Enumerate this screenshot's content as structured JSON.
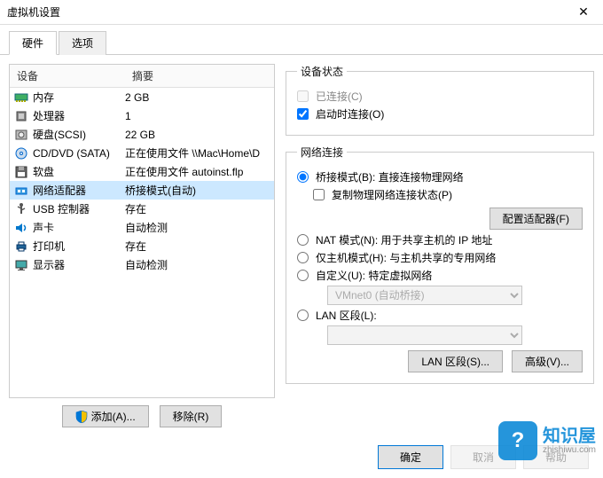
{
  "window": {
    "title": "虚拟机设置",
    "close": "✕"
  },
  "tabs": [
    {
      "label": "硬件",
      "active": true
    },
    {
      "label": "选项",
      "active": false
    }
  ],
  "hw_header": {
    "device": "设备",
    "summary": "摘要"
  },
  "hardware": [
    {
      "icon": "memory",
      "name": "内存",
      "summary": "2 GB"
    },
    {
      "icon": "cpu",
      "name": "处理器",
      "summary": "1"
    },
    {
      "icon": "hdd",
      "name": "硬盘(SCSI)",
      "summary": "22 GB"
    },
    {
      "icon": "cd",
      "name": "CD/DVD (SATA)",
      "summary": "正在使用文件 \\\\Mac\\Home\\D"
    },
    {
      "icon": "floppy",
      "name": "软盘",
      "summary": "正在使用文件 autoinst.flp"
    },
    {
      "icon": "net",
      "name": "网络适配器",
      "summary": "桥接模式(自动)",
      "selected": true
    },
    {
      "icon": "usb",
      "name": "USB 控制器",
      "summary": "存在"
    },
    {
      "icon": "sound",
      "name": "声卡",
      "summary": "自动检测"
    },
    {
      "icon": "printer",
      "name": "打印机",
      "summary": "存在"
    },
    {
      "icon": "display",
      "name": "显示器",
      "summary": "自动检测"
    }
  ],
  "buttons": {
    "add": "添加(A)...",
    "remove": "移除(R)"
  },
  "device_state": {
    "legend": "设备状态",
    "connected": "已连接(C)",
    "connect_on_power": "启动时连接(O)"
  },
  "net_conn": {
    "legend": "网络连接",
    "bridged": "桥接模式(B): 直接连接物理网络",
    "copy_state": "复制物理网络连接状态(P)",
    "configure": "配置适配器(F)",
    "nat": "NAT 模式(N): 用于共享主机的 IP 地址",
    "host_only": "仅主机模式(H): 与主机共享的专用网络",
    "custom": "自定义(U): 特定虚拟网络",
    "vmnet_sel": "VMnet0 (自动桥接)",
    "lan_seg": "LAN 区段(L):",
    "lan_seg_btn": "LAN 区段(S)...",
    "advanced": "高级(V)..."
  },
  "footer": {
    "ok": "确定",
    "cancel": "取消",
    "help": "帮助"
  },
  "watermark": {
    "brand": "知识屋",
    "url": "zhishiwu.com",
    "q": "?"
  }
}
